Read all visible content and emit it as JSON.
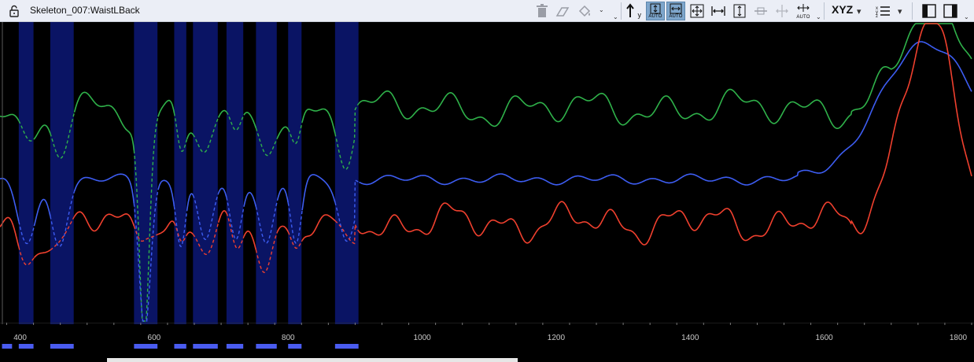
{
  "window": {
    "title": "Skeleton_007:WaistLBack"
  },
  "toolbar": {
    "auto_label_1": "AUTO",
    "auto_label_2": "AUTO",
    "auto_label_3": "AUTO",
    "axis_mode_label": "XYZ",
    "y_label": "y",
    "icons": [
      "lock-icon",
      "delete-icon",
      "eraser-icon",
      "fill-icon",
      "arrow-y-icon",
      "auto-scale-y-icon",
      "auto-scale-x-icon",
      "pan-all-icon",
      "fit-horizontal-icon",
      "fit-vertical-icon",
      "slider-icon",
      "stretch-icon",
      "auto-fit-icon",
      "xyz-icon",
      "list-icon",
      "panel-left-icon",
      "panel-right-icon"
    ]
  },
  "chart_data": {
    "type": "line",
    "x_ticks": [
      "400",
      "600",
      "800",
      "1000",
      "1200",
      "1400",
      "1600",
      "1800"
    ],
    "xlim": [
      370,
      1820
    ],
    "series": [
      {
        "color": "#2fb24a",
        "line": "solid/dashed-in-gaps"
      },
      {
        "color": "#3d5df2",
        "line": "solid/dashed-in-gaps"
      },
      {
        "color": "#f0402e",
        "line": "solid/dashed-in-gaps"
      }
    ],
    "gap_ranges": [
      [
        398,
        420
      ],
      [
        445,
        480
      ],
      [
        570,
        605
      ],
      [
        630,
        648
      ],
      [
        658,
        695
      ],
      [
        708,
        733
      ],
      [
        752,
        783
      ],
      [
        800,
        820
      ],
      [
        870,
        905
      ]
    ],
    "colors": {
      "background": "#000000",
      "gap_fill": "#0a1464",
      "gap_bar": "#4a5cf0",
      "green": "#2fb24a",
      "blue": "#3d5df2",
      "red": "#f0402e"
    }
  }
}
